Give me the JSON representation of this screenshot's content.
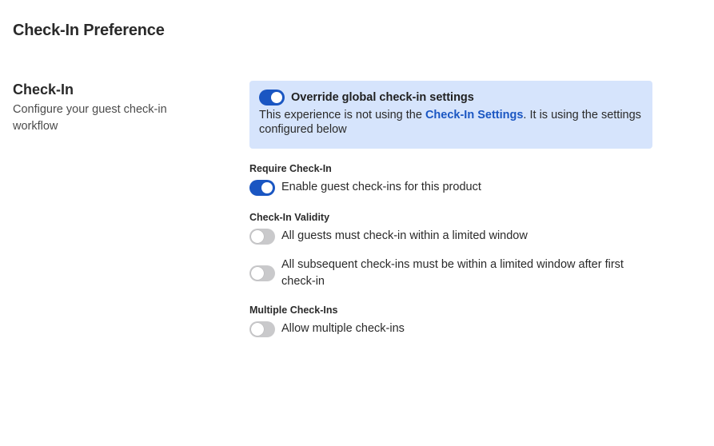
{
  "page": {
    "title": "Check-In Preference"
  },
  "section": {
    "title": "Check-In",
    "description": "Configure your guest check-in workflow"
  },
  "override": {
    "toggle_on": true,
    "title": "Override global check-in settings",
    "text_before": "This experience is not using the ",
    "link": "Check-In Settings",
    "text_after": ". It is using the settings configured below",
    "background": "#d6e4fc"
  },
  "require": {
    "label": "Require Check-In",
    "option": "Enable guest check-ins for this product",
    "toggle_on": true
  },
  "validity": {
    "label": "Check-In Validity",
    "option1": "All guests must check-in within a limited window",
    "option1_on": false,
    "option2": "All subsequent check-ins must be within a limited window after first check-in",
    "option2_on": false
  },
  "multiple": {
    "label": "Multiple Check-Ins",
    "option": "Allow multiple check-ins",
    "toggle_on": false
  },
  "colors": {
    "accent": "#1a56c2",
    "toggle_off": "#c9c9cb"
  }
}
